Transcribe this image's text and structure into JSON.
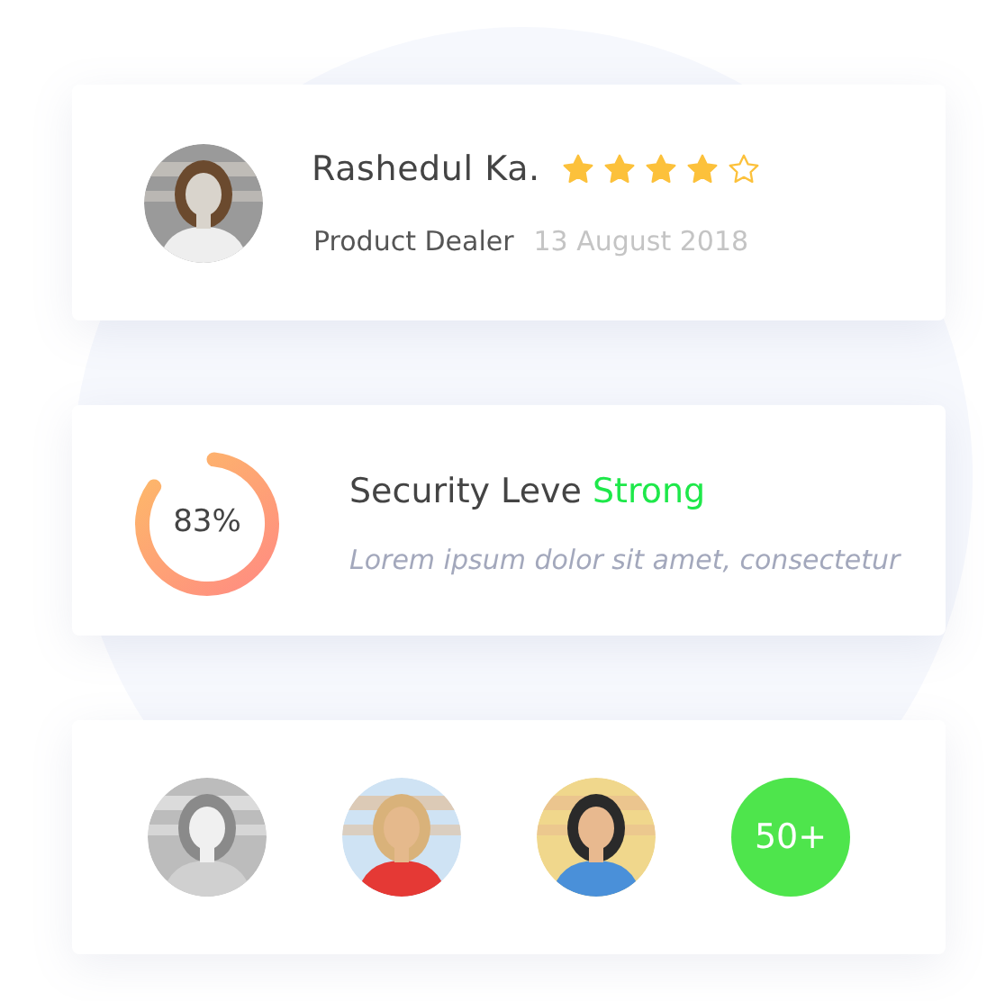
{
  "profile": {
    "name": "Rashedul Ka.",
    "stars": 4,
    "role": "Product Dealer",
    "date": "13 August 2018"
  },
  "security": {
    "level": 0.83,
    "percent": "83%",
    "label": "Security Leve",
    "status": "Strong",
    "description": "Lorem ipsum dolor sit amet, consectetur"
  },
  "members": {
    "more": "50+"
  }
}
